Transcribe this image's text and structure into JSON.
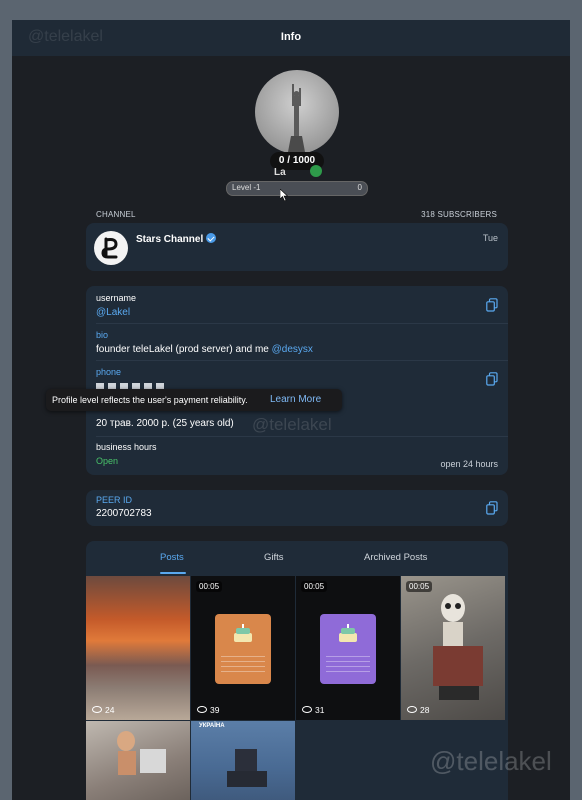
{
  "header": {
    "title": "Info"
  },
  "watermark": "@telelakel",
  "profile": {
    "level_badge": "0 / 1000",
    "name_peek": "La",
    "level_label": "Level -1",
    "level_value": "0"
  },
  "channel": {
    "section_label": "CHANNEL",
    "subscribers": "318 SUBSCRIBERS",
    "name": "Stars Channel",
    "date": "Tue"
  },
  "info": {
    "username_label": "username",
    "username_value": "@Lakel",
    "bio_label": "bio",
    "bio_text": "founder teleLakel (prod server) and me ",
    "bio_link": "@desysx",
    "phone_label": "phone",
    "birthday_value": "20 трав. 2000 р. (25 years old)",
    "business_label": "business hours",
    "business_status": "Open",
    "business_hours": "open 24 hours"
  },
  "tooltip": {
    "text": "Profile level reflects the user's payment reliability.",
    "link": "Learn More"
  },
  "peer": {
    "label": "PEER ID",
    "value": "2200702783"
  },
  "tabs": [
    {
      "label": "Posts"
    },
    {
      "label": "Gifts"
    },
    {
      "label": "Archived Posts"
    }
  ],
  "media": [
    {
      "duration": "",
      "views": "24"
    },
    {
      "duration": "00:05",
      "views": "39"
    },
    {
      "duration": "00:05",
      "views": "31"
    },
    {
      "duration": "00:05",
      "views": "28"
    }
  ],
  "media_row2_label": "УКРАЇНА",
  "colors": {
    "accent": "#5aa9f0",
    "open_green": "#49c36a",
    "card_bg": "#1f2b38",
    "gift_orange": "#d9874b",
    "gift_purple": "#8f6bd8"
  },
  "icons": [
    "copy-icon",
    "verified-icon",
    "eye-icon",
    "cursor-icon"
  ]
}
